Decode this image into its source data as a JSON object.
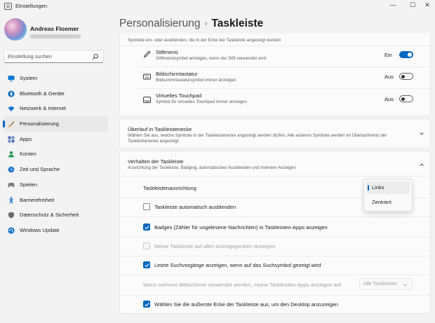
{
  "window": {
    "title": "Einstellungen",
    "minimize": "—",
    "maximize": "☐",
    "close": "✕"
  },
  "user": {
    "name": "Andreas Floemer"
  },
  "search": {
    "placeholder": "Einstellung suchen"
  },
  "sidebar": {
    "items": [
      {
        "label": "System",
        "icon": "monitor-icon",
        "color": "#0078d4"
      },
      {
        "label": "Bluetooth & Geräte",
        "icon": "bluetooth-icon",
        "color": "#0067c0"
      },
      {
        "label": "Netzwerk & Internet",
        "icon": "wifi-icon",
        "color": "#1a73c9"
      },
      {
        "label": "Personalisierung",
        "icon": "brush-icon",
        "color": "#e38b31",
        "active": true
      },
      {
        "label": "Apps",
        "icon": "apps-icon",
        "color": "#4a6cb8"
      },
      {
        "label": "Konten",
        "icon": "person-icon",
        "color": "#2a9d5a"
      },
      {
        "label": "Zeit und Sprache",
        "icon": "globe-clock-icon",
        "color": "#1a73c9"
      },
      {
        "label": "Spielen",
        "icon": "gamepad-icon",
        "color": "#7a7a7a"
      },
      {
        "label": "Barrierefreiheit",
        "icon": "accessibility-icon",
        "color": "#1a73c9"
      },
      {
        "label": "Datenschutz & Sicherheit",
        "icon": "shield-icon",
        "color": "#6b6b6b"
      },
      {
        "label": "Windows Update",
        "icon": "update-icon",
        "color": "#0067c0"
      }
    ]
  },
  "breadcrumb": {
    "parent": "Personalisierung",
    "separator": "›",
    "current": "Taskleiste"
  },
  "pen_section": {
    "header_desc": "Symbole ein- oder ausblenden, die in der Ecke der Taskleiste angezeigt werden",
    "rows": [
      {
        "title": "Stiftmenü",
        "desc": "Stiftmenüsymbol anzeigen, wenn der Stift verwendet wird",
        "state": "Ein",
        "on": true,
        "icon": "pen-icon"
      },
      {
        "title": "Bildschirmtastatur",
        "desc": "Bildschirmtastatursymbol immer anzeigen",
        "state": "Aus",
        "on": false,
        "icon": "keyboard-icon"
      },
      {
        "title": "Virtuelles Touchpad",
        "desc": "Symbol für virtuelles Touchpad immer anzeigen",
        "state": "Aus",
        "on": false,
        "icon": "touchpad-icon"
      }
    ]
  },
  "overflow_section": {
    "title": "Überlauf in Taskleistenecke",
    "desc_line1": "Wählen Sie aus, welche Symbole in der Taskleistenecke angezeigt werden dürfen. Alle anderen Symbole werden im Überlaufmenü der",
    "desc_line2": "Taskleistenecke angezeigt."
  },
  "behavior_section": {
    "title": "Verhalten der Taskleiste",
    "desc": "Ausrichtung der Taskleiste, Badging, automatisches Ausblenden und mehrere Anzeigen",
    "alignment_label": "Taskleistenausrichtung",
    "alignment_options": [
      "Links",
      "Zentriert"
    ],
    "alignment_selected": "Links",
    "checkboxes": [
      {
        "label": "Taskleiste automatisch ausblenden",
        "checked": false,
        "disabled": false
      },
      {
        "label": "Badges (Zähler für ungelesene Nachrichten) in Taskleisten-Apps anzeigen",
        "checked": true,
        "disabled": false
      },
      {
        "label": "Meine Taskleiste auf allen Anzeigegeräten anzeigen",
        "checked": false,
        "disabled": true
      },
      {
        "label": "Letzte Suchvorgänge anzeigen, wenn auf das Suchsymbol gezeigt wird",
        "checked": true,
        "disabled": false
      }
    ],
    "multi_display_label": "Wenn mehrere Bildschirme verwendet werden, meine Taskleisten-Apps anzeigen auf",
    "multi_display_value": "Alle Taskleisten",
    "corner_checkbox": {
      "label": "Wählen Sie die äußerste Ecke der Taskleiste aus, um den Desktop anzuzeigen",
      "checked": true
    }
  },
  "colors": {
    "accent": "#0067c0",
    "background": "#f3f3f3",
    "card": "#fbfbfb"
  }
}
